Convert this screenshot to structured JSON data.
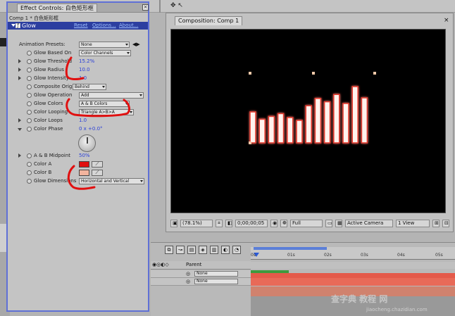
{
  "effect_controls": {
    "tab_title": "Effect Controls: 白色矩形框",
    "close_glyph": "×",
    "comp_path": "Comp 1 * 白色矩形框",
    "effect_name": "Glow",
    "links": {
      "reset": "Reset",
      "options": "Options...",
      "about": "About..."
    },
    "properties": [
      {
        "label": "Animation Presets:",
        "value": "None",
        "kind": "dropdown"
      },
      {
        "label": "Glow Based On",
        "value": "Color Channels",
        "kind": "dropdown"
      },
      {
        "label": "Glow Threshold",
        "value": "15.2%",
        "kind": "value"
      },
      {
        "label": "Glow Radius",
        "value": "10.0",
        "kind": "value"
      },
      {
        "label": "Glow Intensity",
        "value": "1.0",
        "kind": "value"
      },
      {
        "label": "Composite Original",
        "value": "Behind",
        "kind": "dropdown"
      },
      {
        "label": "Glow Operation",
        "value": "Add",
        "kind": "dropdown"
      },
      {
        "label": "Glow Colors",
        "value": "A & B Colors",
        "kind": "dropdown"
      },
      {
        "label": "Color Looping",
        "value": "Triangle A>B>A",
        "kind": "dropdown"
      },
      {
        "label": "Color Loops",
        "value": "1.0",
        "kind": "value"
      },
      {
        "label": "Color Phase",
        "value": "0 x +0.0°",
        "kind": "value"
      },
      {
        "label": "A & B Midpoint",
        "value": "50%",
        "kind": "value"
      },
      {
        "label": "Color A",
        "value": "#e01010",
        "kind": "color"
      },
      {
        "label": "Color B",
        "value": "#f2b49e",
        "kind": "color"
      },
      {
        "label": "Glow Dimensions",
        "value": "Horizontal and Vertical",
        "kind": "dropdown"
      }
    ]
  },
  "composition": {
    "tab_title": "Composition: Comp 1",
    "close_glyph": "×",
    "bars_relative_heights": [
      0.55,
      0.42,
      0.47,
      0.52,
      0.45,
      0.4,
      0.66,
      0.79,
      0.73,
      0.86,
      0.7,
      1.0,
      0.8
    ],
    "footer": {
      "zoom": "(78.1%)",
      "timecode": "0;00;00;05",
      "resolution": "Full",
      "camera": "Active Camera",
      "views": "1 View"
    }
  },
  "timeline": {
    "parent_label": "Parent",
    "layers": [
      {
        "parent": "None"
      },
      {
        "parent": "None"
      }
    ],
    "ruler_ticks": [
      "0s",
      "01s",
      "02s",
      "03s",
      "04s",
      "05s"
    ]
  },
  "top_strip": {
    "glyphs": "✥ ↖"
  },
  "watermark": {
    "cn": "查字典 教程 网",
    "url": "jiaocheng.chazidian.com"
  },
  "colors": {
    "panel_border": "#5f70d6",
    "annotation": "#e01010",
    "effect_header": "#2c3ea0",
    "value_link": "#2a3fd8"
  }
}
